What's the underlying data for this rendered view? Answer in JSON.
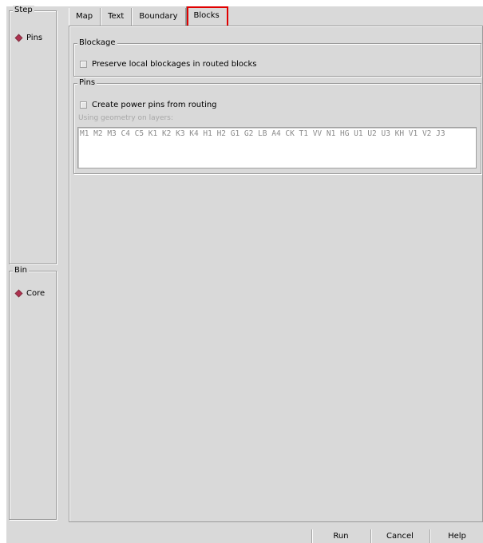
{
  "step_group": {
    "title": "Step",
    "items": [
      {
        "label": "Pins",
        "selected": true
      }
    ]
  },
  "bin_group": {
    "title": "Bin",
    "items": [
      {
        "label": "Core",
        "selected": true
      }
    ]
  },
  "tabs": [
    {
      "label": "Map",
      "active": false
    },
    {
      "label": "Text",
      "active": false
    },
    {
      "label": "Boundary",
      "active": false
    },
    {
      "label": "Blocks",
      "active": true
    }
  ],
  "blockage": {
    "title": "Blockage",
    "preserve_label": "Preserve local blockages in routed blocks",
    "preserve_checked": false
  },
  "pins": {
    "title": "Pins",
    "power_pins_label": "Create power pins from routing",
    "power_pins_checked": false,
    "layers_hint": "Using geometry on layers:",
    "layers_value": "M1 M2 M3 C4 C5 K1 K2 K3 K4 H1 H2 G1 G2 LB A4 CK T1 VV N1 HG U1 U2 U3 KH V1 V2 J3"
  },
  "buttons": {
    "run": "Run",
    "cancel": "Cancel",
    "help": "Help"
  },
  "colors": {
    "window_bg": "#d9d9d9",
    "radio_selected": "#b03050",
    "highlight": "#e00000"
  }
}
